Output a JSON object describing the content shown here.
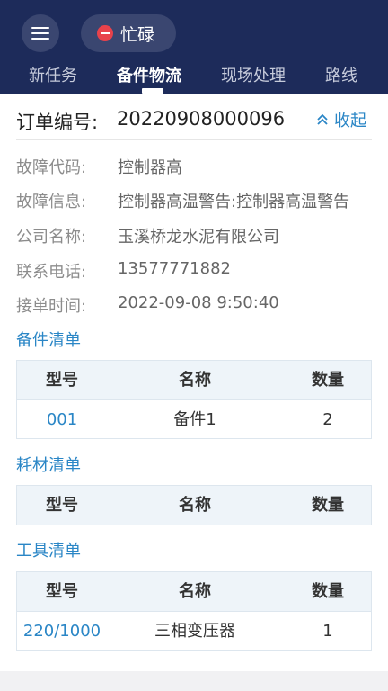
{
  "header": {
    "status_label": "忙碌",
    "colors": {
      "bar": "#1d2b5a",
      "pill": "#3a4670",
      "status_dot": "#e8424b"
    },
    "icons": {
      "menu": "hamburger-menu-icon",
      "status": "do-not-disturb-icon"
    }
  },
  "tabs": [
    {
      "label": "新任务"
    },
    {
      "label": "备件物流"
    },
    {
      "label": "现场处理"
    },
    {
      "label": "路线"
    }
  ],
  "order": {
    "label": "订单编号:",
    "number": "20220908000096",
    "collapse_label": "收起",
    "collapse_icon": "double-chevron-up-icon"
  },
  "info": [
    {
      "label": "故障代码:",
      "value": "控制器高"
    },
    {
      "label": "故障信息:",
      "value": "控制器高温警告:控制器高温警告"
    },
    {
      "label": "公司名称:",
      "value": "玉溪桥龙水泥有限公司"
    },
    {
      "label": "联系电话:",
      "value": "13577771882"
    },
    {
      "label": "接单时间:",
      "value": "2022-09-08 9:50:40"
    }
  ],
  "spare_parts": {
    "title": "备件清单",
    "headers": [
      "型号",
      "名称",
      "数量"
    ],
    "rows": [
      {
        "model": "001",
        "name": "备件1",
        "qty": "2"
      }
    ]
  },
  "consumables": {
    "title": "耗材清单",
    "headers": [
      "型号",
      "名称",
      "数量"
    ],
    "rows": []
  },
  "tools": {
    "title": "工具清单",
    "headers": [
      "型号",
      "名称",
      "数量"
    ],
    "rows": [
      {
        "model": "220/1000",
        "name": "三相变压器",
        "qty": "1"
      }
    ]
  },
  "accent_color": "#2a86c6"
}
